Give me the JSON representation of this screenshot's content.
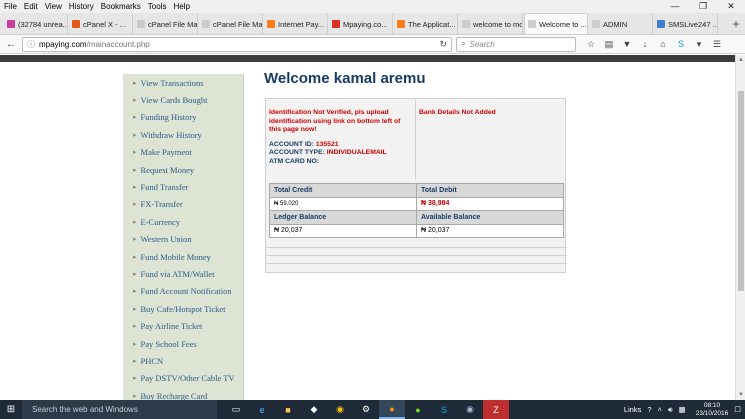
{
  "menu": [
    "File",
    "Edit",
    "View",
    "History",
    "Bookmarks",
    "Tools",
    "Help"
  ],
  "window_controls": [
    "—",
    "❐",
    "✕"
  ],
  "tabs": [
    {
      "label": "(32784 unrea...",
      "color": "#c63f98",
      "active": false
    },
    {
      "label": "cPanel X - ...",
      "color": "#e25a1c",
      "active": false
    },
    {
      "label": "cPanel File Mana...",
      "color": "#cccccc",
      "active": false
    },
    {
      "label": "cPanel File Mana...",
      "color": "#cccccc",
      "active": false
    },
    {
      "label": "Internet Pay...",
      "color": "#ff7a1a",
      "active": false
    },
    {
      "label": "Mpaying.co...",
      "color": "#d93025",
      "active": false
    },
    {
      "label": "The Applicat...",
      "color": "#ff7a1a",
      "active": false
    },
    {
      "label": "welcome to mob...",
      "color": "#cccccc",
      "active": false
    },
    {
      "label": "Welcome to ...",
      "color": "#cccccc",
      "active": true
    },
    {
      "label": "ADMIN",
      "color": "#cccccc",
      "active": false
    },
    {
      "label": "SMSLive247 ...",
      "color": "#3b7fd1",
      "active": false
    }
  ],
  "nav": {
    "url_domain": "mpaying.com",
    "url_path": "/mainaccount.php",
    "search_placeholder": "Search"
  },
  "sidebar": [
    "View Transactions",
    "View Cards Bought",
    "Funding History",
    "Withdraw History",
    "Make Payment",
    "Request Money",
    "Fund Transfer",
    "FX-Transfer",
    "E-Currency",
    "Western Union",
    "Fund Mobile Money",
    "Fund via ATM/Wallet",
    "Fund Account Notification",
    "Buy Cafe/Hotspot Ticket",
    "Pay Airline Ticket",
    "Pay School Fees",
    "PHCN",
    "Pay DSTV/Other Cable TV",
    "Buy Recharge Card"
  ],
  "welcome": {
    "prefix": "Welcome",
    "name": "kamal aremu"
  },
  "account": {
    "warning": "Identification Not Verified, pls upload identification using link on bottom left of this page now!",
    "bank_msg": "Bank Details Not Added",
    "id_label": "ACCOUNT ID:",
    "id_value": "135521",
    "type_label": "ACCOUNT TYPE:",
    "type_value": "INDIVIDUALEMAIL",
    "atm_label": "ATM CARD NO:"
  },
  "balances": {
    "total_credit_label": "Total Credit",
    "total_debit_label": "Total Debit",
    "total_credit": "₦ 59,020",
    "total_debit": "₦ 38,984",
    "ledger_label": "Ledger Balance",
    "available_label": "Available Balance",
    "ledger": "₦ 20,037",
    "available": "₦ 20,037"
  },
  "taskbar": {
    "search_placeholder": "Search the web and Windows",
    "links": "Links",
    "time": "08:10",
    "date": "23/10/2016"
  }
}
